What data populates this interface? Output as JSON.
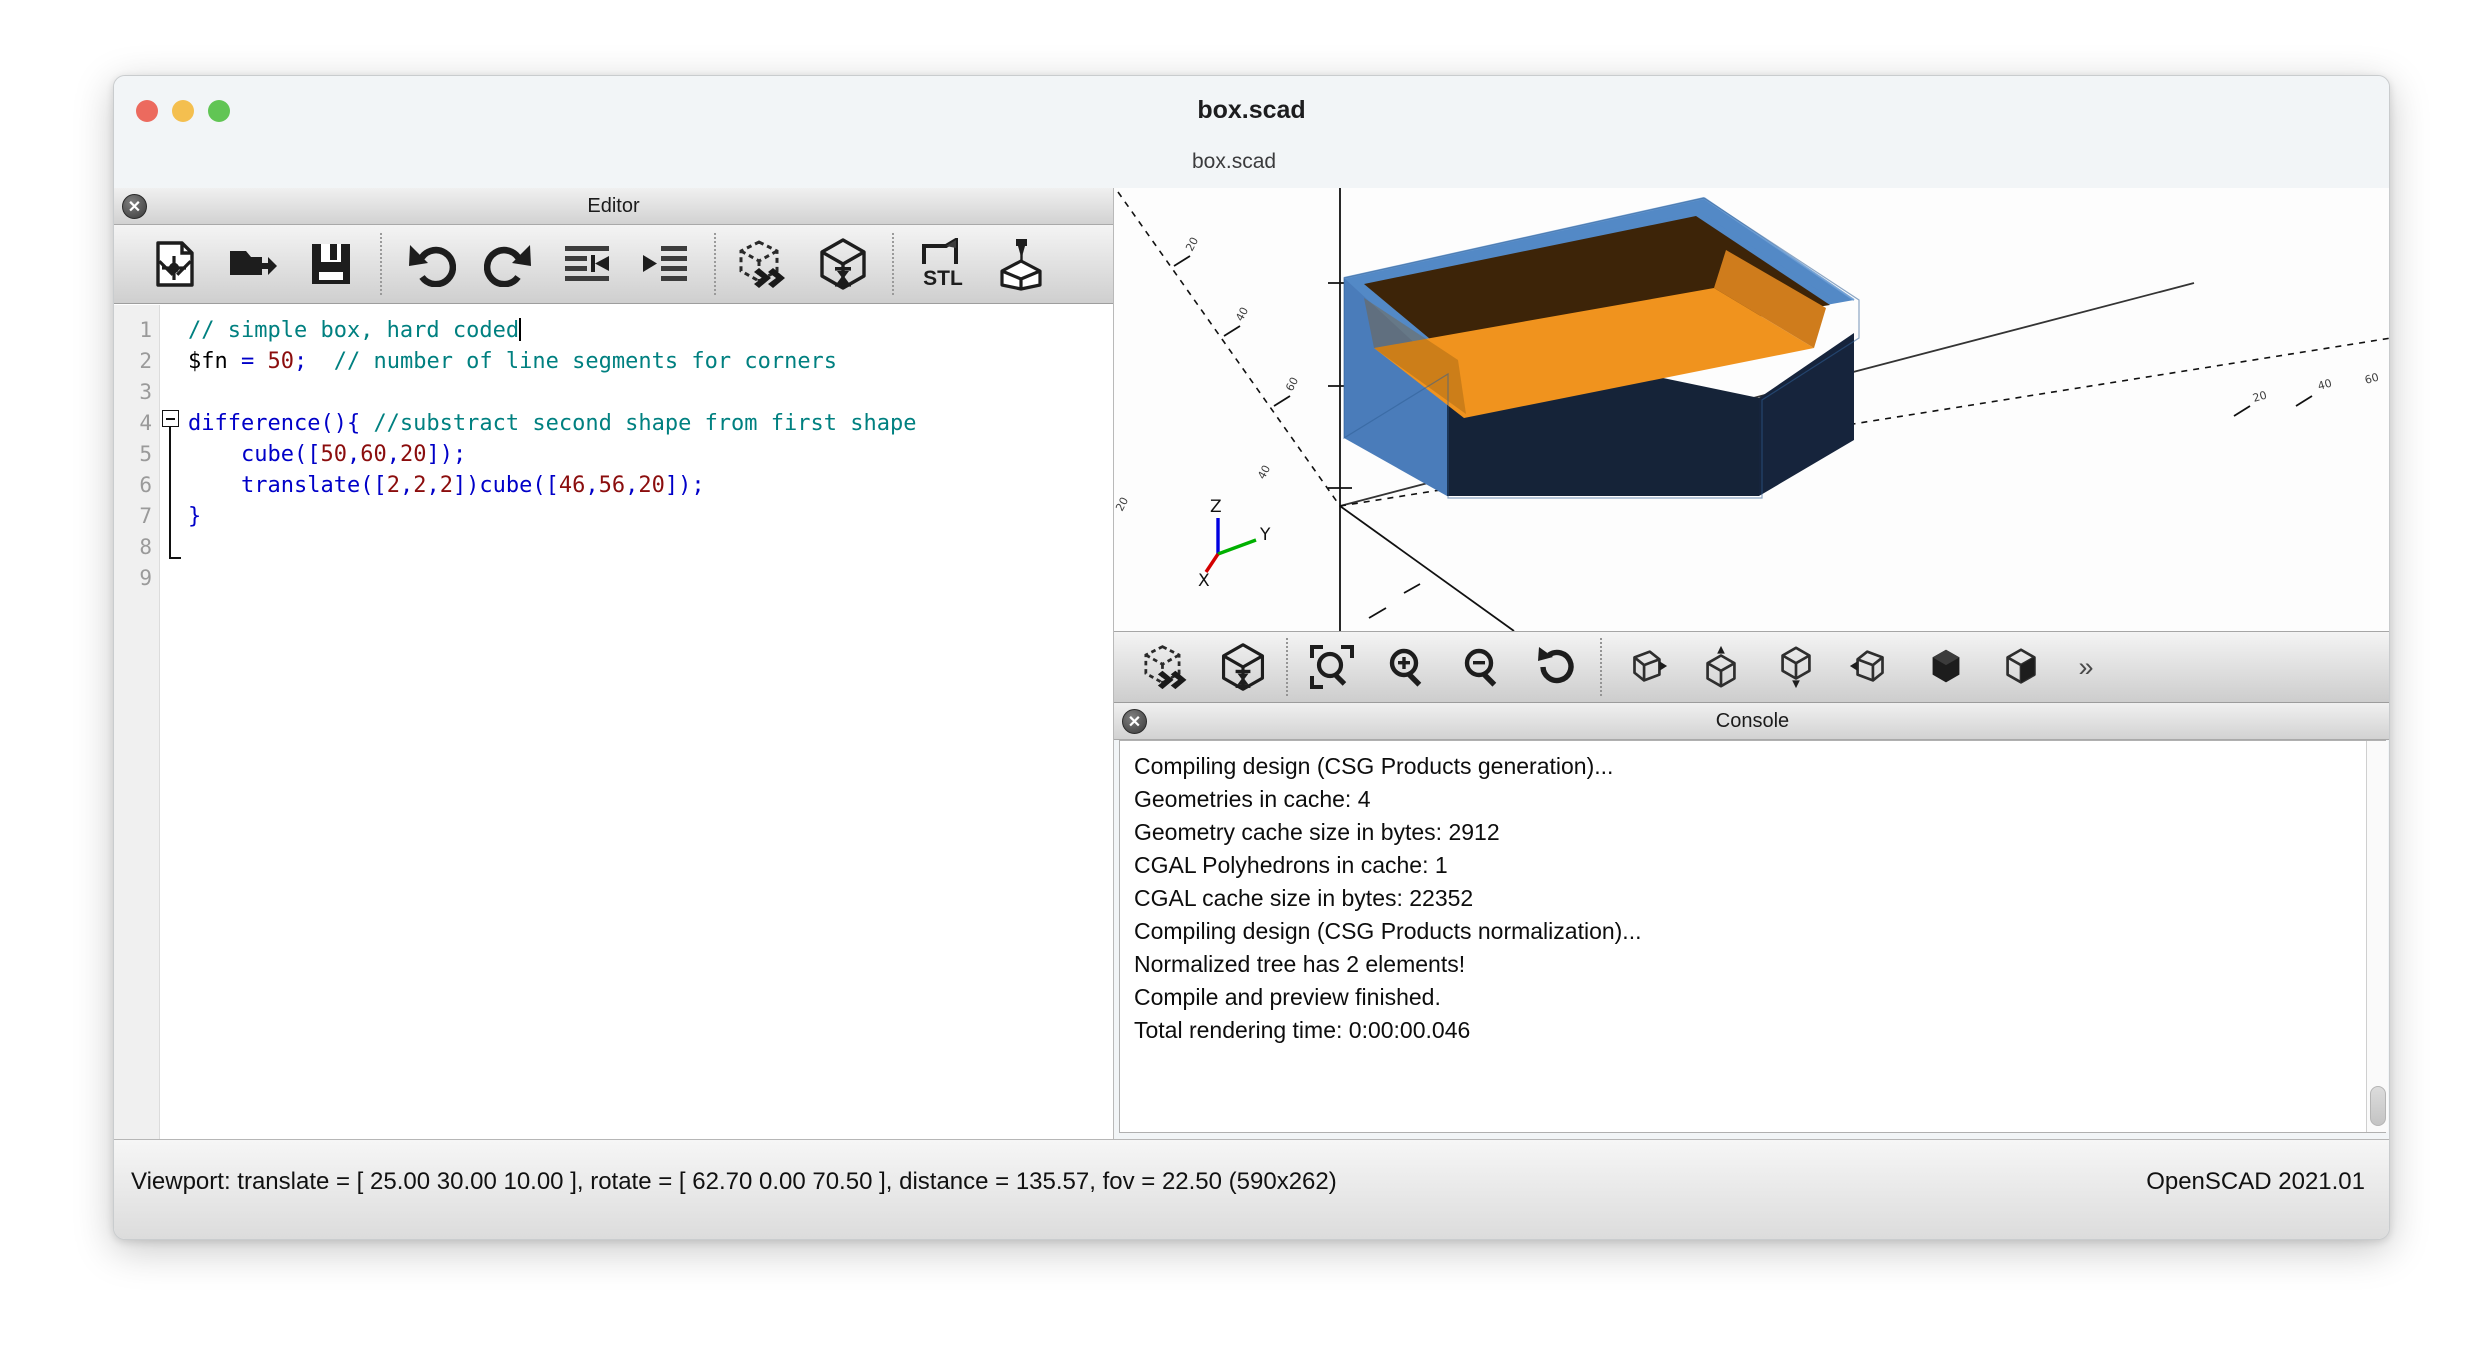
{
  "window": {
    "title": "box.scad",
    "traffic_lights": [
      "close",
      "minimize",
      "maximize"
    ]
  },
  "tabbar": {
    "active_tab": "box.scad"
  },
  "editor": {
    "dock_title": "Editor",
    "close_label": "✕",
    "toolbar": [
      {
        "name": "new-file-icon",
        "tooltip": "New"
      },
      {
        "name": "open-file-icon",
        "tooltip": "Open"
      },
      {
        "name": "save-file-icon",
        "tooltip": "Save"
      },
      {
        "name": "undo-icon",
        "tooltip": "Undo"
      },
      {
        "name": "redo-icon",
        "tooltip": "Redo"
      },
      {
        "name": "unindent-icon",
        "tooltip": "Unindent"
      },
      {
        "name": "indent-icon",
        "tooltip": "Indent"
      },
      {
        "name": "preview-icon",
        "tooltip": "Preview"
      },
      {
        "name": "render-icon",
        "tooltip": "Render"
      },
      {
        "name": "export-stl-icon",
        "tooltip": "Export as STL"
      },
      {
        "name": "send-to-printer-icon",
        "tooltip": "Send to 3D Print Service"
      }
    ],
    "line_numbers": [
      "1",
      "2",
      "3",
      "4",
      "5",
      "6",
      "7",
      "8",
      "9"
    ],
    "code_lines": [
      {
        "n": 1,
        "tokens": [
          {
            "t": "com",
            "s": "// simple box, hard coded"
          }
        ],
        "caret": true
      },
      {
        "n": 2,
        "tokens": [
          {
            "t": "pln",
            "s": "$fn "
          },
          {
            "t": "op",
            "s": "="
          },
          {
            "t": "pln",
            "s": " "
          },
          {
            "t": "num",
            "s": "50"
          },
          {
            "t": "op",
            "s": ";"
          },
          {
            "t": "pln",
            "s": "  "
          },
          {
            "t": "com",
            "s": "// number of line segments for corners"
          }
        ]
      },
      {
        "n": 3,
        "tokens": []
      },
      {
        "n": 4,
        "tokens": [
          {
            "t": "kw",
            "s": "difference(){"
          },
          {
            "t": "pln",
            "s": " "
          },
          {
            "t": "com",
            "s": "//substract second shape from first shape"
          }
        ]
      },
      {
        "n": 5,
        "tokens": [
          {
            "t": "pln",
            "s": "    "
          },
          {
            "t": "kw",
            "s": "cube(["
          },
          {
            "t": "num",
            "s": "50"
          },
          {
            "t": "kw",
            "s": ","
          },
          {
            "t": "num",
            "s": "60"
          },
          {
            "t": "kw",
            "s": ","
          },
          {
            "t": "num",
            "s": "20"
          },
          {
            "t": "kw",
            "s": "]);"
          }
        ]
      },
      {
        "n": 6,
        "tokens": [
          {
            "t": "pln",
            "s": "    "
          },
          {
            "t": "kw",
            "s": "translate(["
          },
          {
            "t": "num",
            "s": "2"
          },
          {
            "t": "kw",
            "s": ","
          },
          {
            "t": "num",
            "s": "2"
          },
          {
            "t": "kw",
            "s": ","
          },
          {
            "t": "num",
            "s": "2"
          },
          {
            "t": "kw",
            "s": "])cube(["
          },
          {
            "t": "num",
            "s": "46"
          },
          {
            "t": "kw",
            "s": ","
          },
          {
            "t": "num",
            "s": "56"
          },
          {
            "t": "kw",
            "s": ","
          },
          {
            "t": "num",
            "s": "20"
          },
          {
            "t": "kw",
            "s": "]);"
          }
        ]
      },
      {
        "n": 7,
        "tokens": [
          {
            "t": "kw",
            "s": "}"
          }
        ]
      },
      {
        "n": 8,
        "tokens": []
      },
      {
        "n": 9,
        "tokens": []
      }
    ]
  },
  "viewport": {
    "axis_labels": {
      "x": "X",
      "y": "Y",
      "z": "Z"
    },
    "axis_colors": {
      "x": "#d40000",
      "y": "#00b000",
      "z": "#0000e0"
    },
    "model_colors": {
      "outer_left": "#4a7cba",
      "outer_front": "#152338",
      "top_rim": "#5389c6",
      "inner_floor": "#f0931e",
      "inner_wall_right": "#cf7c1c",
      "inner_back": "#3d2408"
    },
    "toolbar": [
      {
        "name": "preview-icon",
        "tooltip": "Preview"
      },
      {
        "name": "render-icon",
        "tooltip": "Render"
      },
      {
        "name": "zoom-all-icon",
        "tooltip": "View All"
      },
      {
        "name": "zoom-in-icon",
        "tooltip": "Zoom In"
      },
      {
        "name": "zoom-out-icon",
        "tooltip": "Zoom Out"
      },
      {
        "name": "reset-view-icon",
        "tooltip": "Reset View"
      },
      {
        "name": "view-right-icon",
        "tooltip": "Right View"
      },
      {
        "name": "view-top-icon",
        "tooltip": "Top View"
      },
      {
        "name": "view-bottom-icon",
        "tooltip": "Bottom View"
      },
      {
        "name": "view-left-icon",
        "tooltip": "Left View"
      },
      {
        "name": "view-front-icon",
        "tooltip": "Front View"
      },
      {
        "name": "view-back-icon",
        "tooltip": "Back View"
      },
      {
        "name": "overflow-icon",
        "tooltip": "More"
      }
    ],
    "overflow_label": "»"
  },
  "console": {
    "dock_title": "Console",
    "close_label": "✕",
    "lines": [
      "Compiling design (CSG Products generation)...",
      "Geometries in cache: 4",
      "Geometry cache size in bytes: 2912",
      "CGAL Polyhedrons in cache: 1",
      "CGAL cache size in bytes: 22352",
      "Compiling design (CSG Products normalization)...",
      "Normalized tree has 2 elements!",
      "Compile and preview finished.",
      "Total rendering time: 0:00:00.046"
    ]
  },
  "statusbar": {
    "viewport_info": "Viewport: translate = [ 25.00 30.00 10.00 ], rotate = [ 62.70 0.00 70.50 ], distance = 135.57, fov = 22.50 (590x262)",
    "version": "OpenSCAD 2021.01"
  }
}
